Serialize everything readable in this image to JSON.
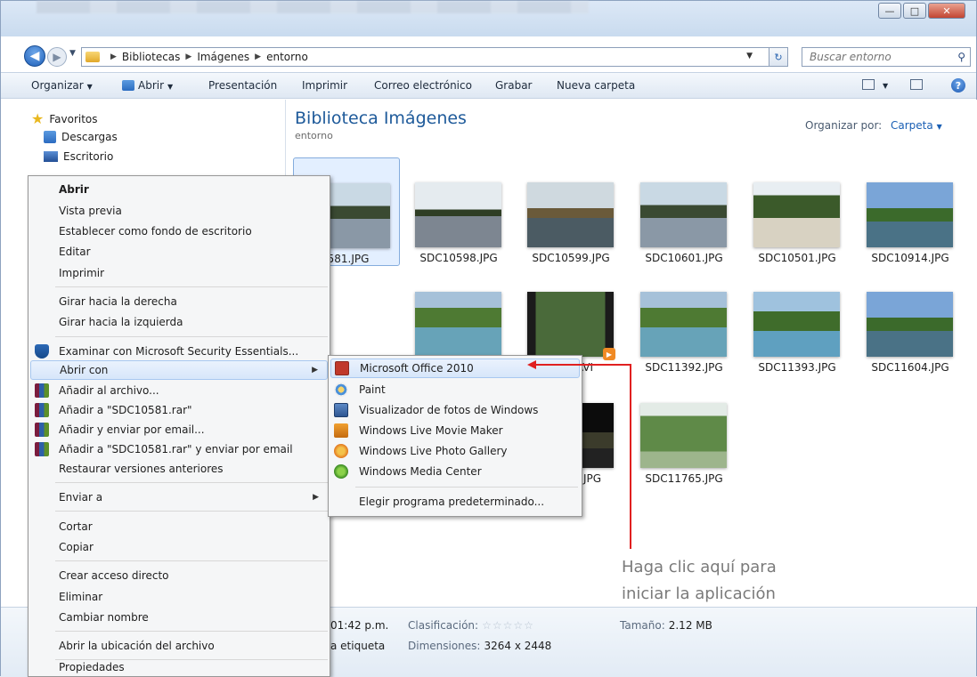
{
  "window": {
    "colors": {
      "accent": "#1e5a9a",
      "annotation": "#e02020",
      "highlight": "#d7e6fa"
    }
  },
  "address": {
    "crumbs": [
      "Bibliotecas",
      "Imágenes",
      "entorno"
    ],
    "search_placeholder": "Buscar entorno"
  },
  "toolbar": {
    "organize": "Organizar",
    "open": "Abrir",
    "presentation": "Presentación",
    "print": "Imprimir",
    "email": "Correo electrónico",
    "burn": "Grabar",
    "new_folder": "Nueva carpeta"
  },
  "sidebar": {
    "items": [
      {
        "label": "Favoritos",
        "icon": "star-icon"
      },
      {
        "label": "Descargas",
        "icon": "download-folder-icon"
      },
      {
        "label": "Escritorio",
        "icon": "desktop-icon"
      }
    ]
  },
  "content": {
    "title": "Biblioteca Imágenes",
    "subtitle": "entorno",
    "arrange_label": "Organizar por:",
    "arrange_value": "Carpeta",
    "thumbnails": [
      {
        "label": "0581.JPG"
      },
      {
        "label": "SDC10598.JPG"
      },
      {
        "label": "SDC10599.JPG"
      },
      {
        "label": "SDC10601.JPG"
      },
      {
        "label": "SDC10501.JPG"
      },
      {
        "label": "SDC10914.JPG"
      },
      {
        "label": ".AVI"
      },
      {
        "label": "SDC11392.JPG"
      },
      {
        "label": "SDC11393.JPG"
      },
      {
        "label": "SDC11604.JPG"
      },
      {
        "label": "JPG"
      },
      {
        "label": "SDC11765.JPG"
      }
    ]
  },
  "details": {
    "time": "01:42 p.m.",
    "tag": "a etiqueta",
    "rating_label": "Clasificación:",
    "rating_stars": "☆☆☆☆☆",
    "dimensions_label": "Dimensiones:",
    "dimensions_value": "3264 x 2448",
    "size_label": "Tamaño:",
    "size_value": "2.12 MB"
  },
  "context_menu": {
    "items": [
      "Abrir",
      "Vista previa",
      "Establecer como fondo de escritorio",
      "Editar",
      "Imprimir",
      "Girar hacia la derecha",
      "Girar hacia la izquierda",
      "Examinar con Microsoft Security Essentials...",
      "Abrir con",
      "Añadir al archivo...",
      "Añadir a \"SDC10581.rar\"",
      "Añadir y enviar por email...",
      "Añadir a \"SDC10581.rar\" y enviar por email",
      "Restaurar versiones anteriores",
      "Enviar a",
      "Cortar",
      "Copiar",
      "Crear acceso directo",
      "Eliminar",
      "Cambiar nombre",
      "Abrir la ubicación del archivo",
      "Propiedades"
    ]
  },
  "open_with": {
    "items": [
      "Microsoft Office 2010",
      "Paint",
      "Visualizador de fotos de Windows",
      "Windows Live Movie Maker",
      "Windows Live Photo Gallery",
      "Windows Media Center",
      "Elegir programa predeterminado..."
    ]
  },
  "annotation": {
    "line1": "Haga clic aquí para",
    "line2": "iniciar la aplicación"
  }
}
